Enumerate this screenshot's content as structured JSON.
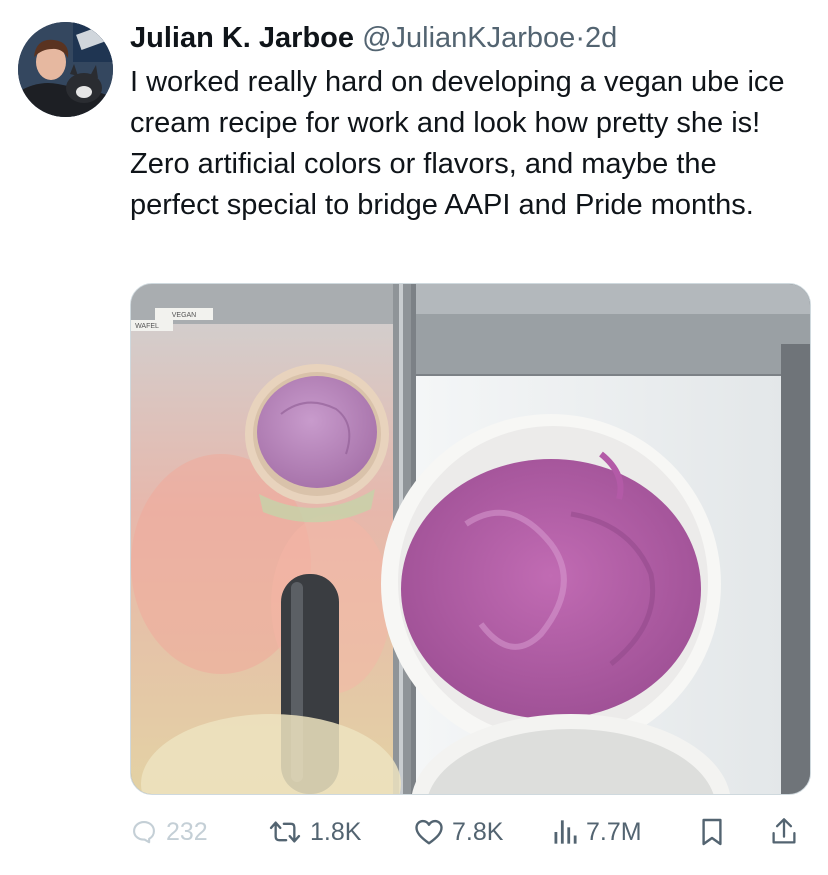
{
  "tweet": {
    "display_name": "Julian K. Jarboe",
    "handle": "@JulianKJarboe",
    "separator": "·",
    "time": "2d",
    "text": "I worked really hard on developing a vegan ube ice cream recipe for work and look how pretty she is! Zero artificial colors or flavors, and maybe the perfect special to bridge AAPI and Pride months.",
    "media": {
      "label_vegan": "VEGAN",
      "label_wafel": "WAFEL"
    }
  },
  "actions": {
    "replies": "232",
    "reposts": "1.8K",
    "likes": "7.8K",
    "views": "7.7M"
  },
  "icons": [
    "reply-icon",
    "repost-icon",
    "like-icon",
    "views-icon",
    "bookmark-icon",
    "share-icon"
  ],
  "colors": {
    "text": "#0f1419",
    "secondary": "#536471",
    "ube": "#b65aa8"
  }
}
